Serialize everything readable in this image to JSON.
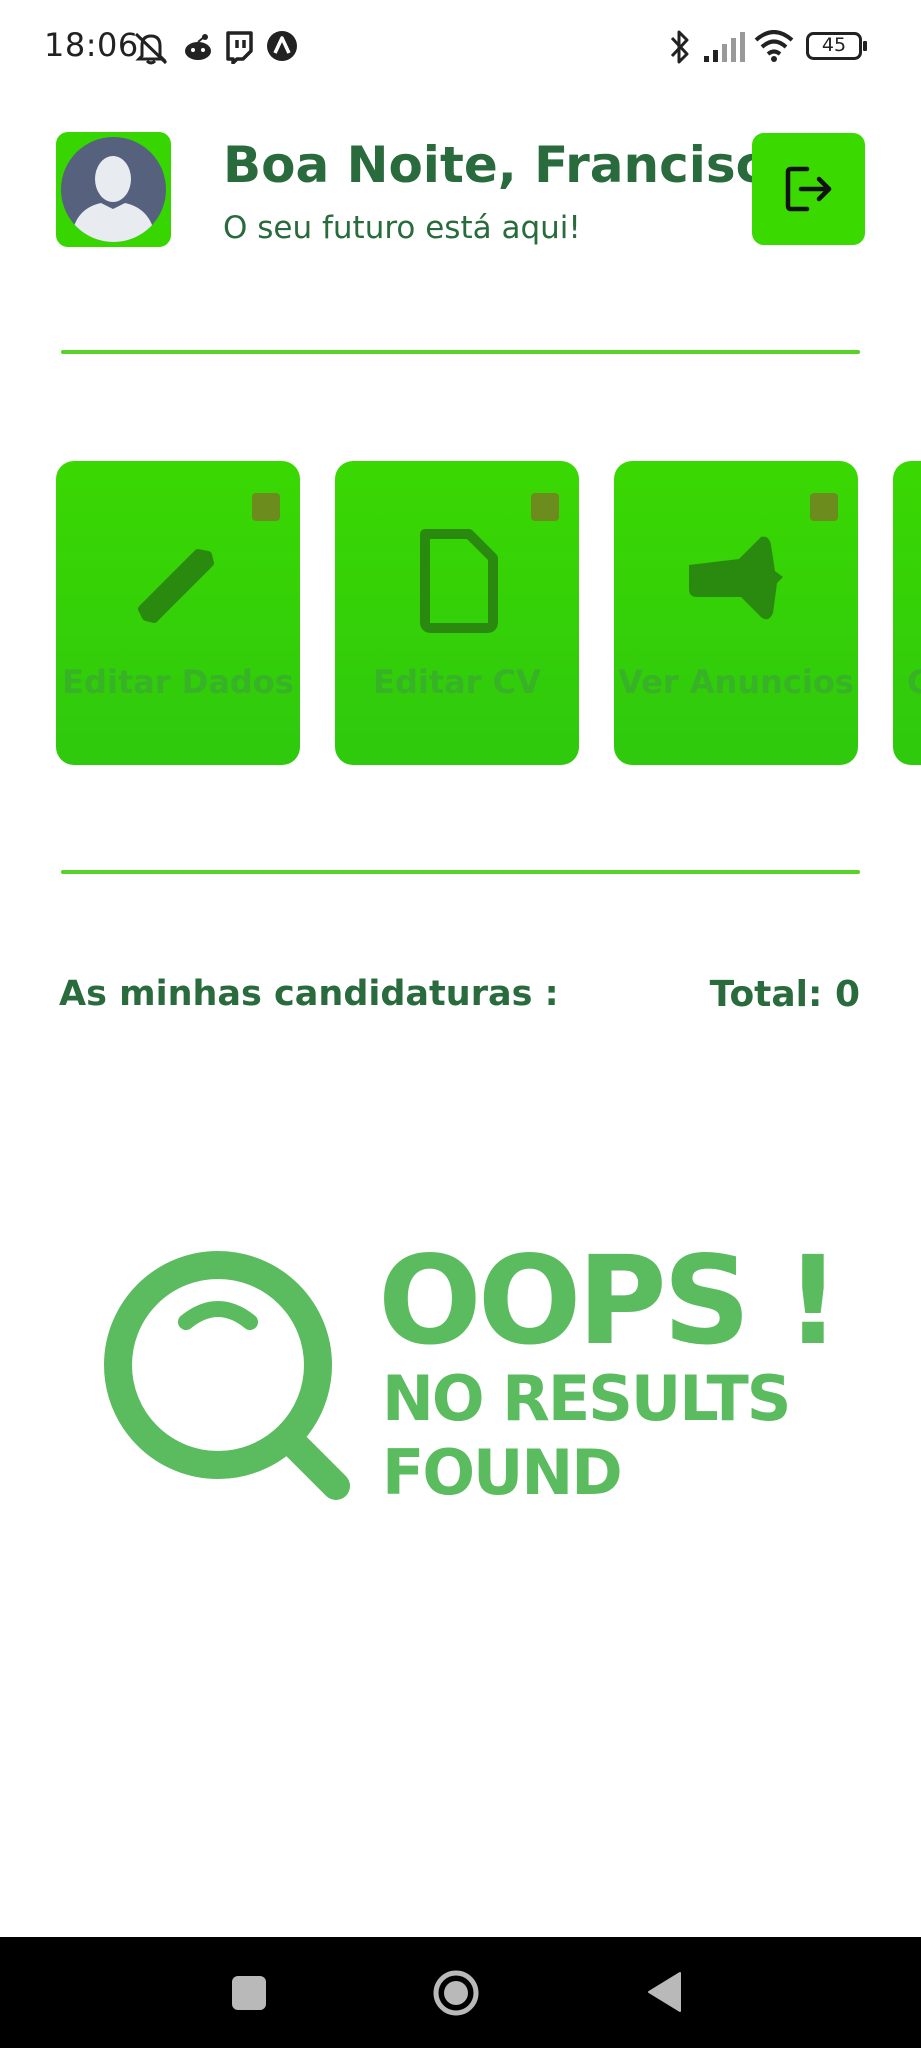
{
  "status_bar": {
    "time": "18:06",
    "battery": "45",
    "icons": [
      "muted-bell-icon",
      "reddit-icon",
      "twitch-icon",
      "arch-icon",
      "bluetooth-icon",
      "signal-icon",
      "wifi-icon",
      "battery-icon"
    ]
  },
  "header": {
    "greeting": "Boa Noite, Francisco",
    "subtitle": "O seu futuro está aqui!"
  },
  "actions": [
    {
      "label": "Editar Dados",
      "icon": "pencil-icon"
    },
    {
      "label": "Editar CV",
      "icon": "document-icon"
    },
    {
      "label": "Ver Anuncios",
      "icon": "megaphone-icon"
    },
    {
      "label": "C",
      "icon": ""
    }
  ],
  "applications": {
    "title": "As minhas candidaturas :",
    "total_label": "Total: 0"
  },
  "empty_state": {
    "title": "OOPS !",
    "line1": "NO RESULTS",
    "line2": "FOUND"
  },
  "colors": {
    "accent_green": "#3ad900",
    "text_green": "#2a6b3d",
    "illustration_green": "#5bbb5f"
  }
}
